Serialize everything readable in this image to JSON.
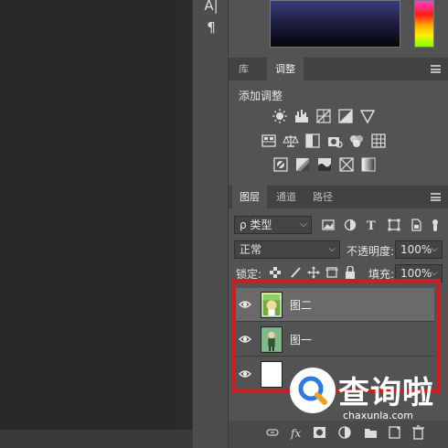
{
  "toolbar": {
    "char_icon": "A|",
    "paragraph_icon": "¶"
  },
  "adjust_tabs": [
    {
      "label": "库"
    },
    {
      "label": "调整"
    }
  ],
  "adjustments": {
    "title": "添加调整",
    "icons": [
      "brightness-icon",
      "levels-icon",
      "curves-icon",
      "exposure-icon",
      "vibrance-icon",
      "hue-saturation-icon",
      "color-balance-icon",
      "black-white-icon",
      "photo-filter-icon",
      "channel-mixer-icon",
      "color-lookup-icon",
      "invert-icon",
      "posterize-icon",
      "threshold-icon",
      "selective-color-icon",
      "gradient-map-icon"
    ]
  },
  "layers_tabs": [
    {
      "label": "图层"
    },
    {
      "label": "通道"
    },
    {
      "label": "路径"
    }
  ],
  "filter": {
    "kind_label": "ρ 类型"
  },
  "blend": {
    "mode": "正常",
    "opacity_label": "不透明度:",
    "opacity_value": "100%"
  },
  "lock": {
    "label": "锁定:",
    "fill_label": "填充:",
    "fill_value": "100%"
  },
  "layers": [
    {
      "name": "图二",
      "selected": true
    },
    {
      "name": "图一",
      "selected": false
    },
    {
      "name": "",
      "selected": false
    }
  ],
  "watermark": {
    "title": "查询啦",
    "url": "chaxunla.com"
  },
  "colors": {
    "highlight": "#d11c1c",
    "selected_row": "#6a6a6a"
  }
}
